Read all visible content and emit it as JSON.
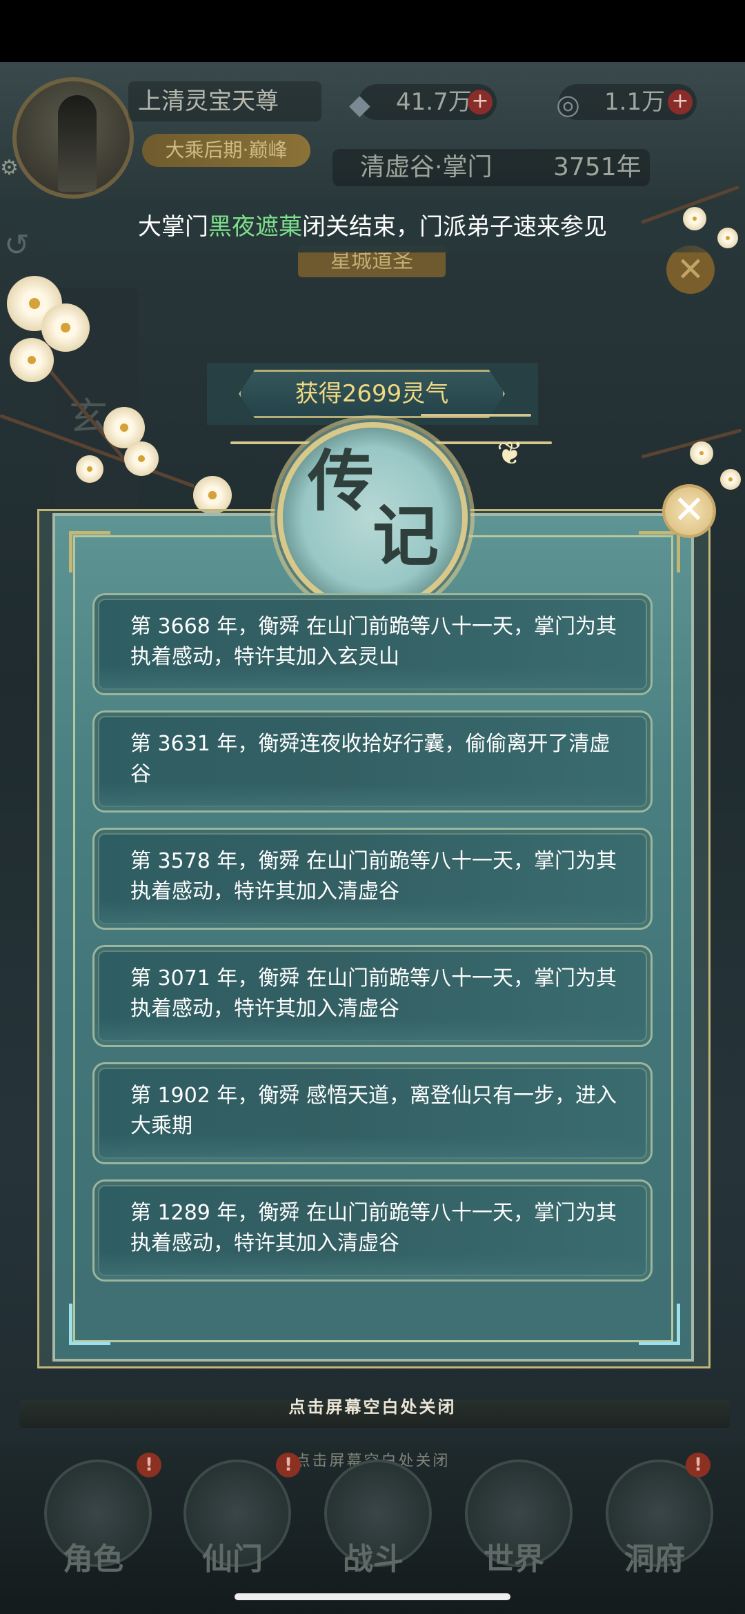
{
  "player": {
    "name": "上清灵宝天尊",
    "rank": "大乘后期·巅峰",
    "settings_icon": "gear-icon"
  },
  "resources": [
    {
      "icon": "spirit-stone-icon",
      "value": "41.7万"
    },
    {
      "icon": "spirit-qi-icon",
      "value": "1.1万"
    }
  ],
  "location": {
    "name": "清虚谷·掌门",
    "year": "3751年"
  },
  "background": {
    "plaque": "星城道圣",
    "side_char": "玄"
  },
  "announcement": {
    "prefix": "大掌门",
    "highlight": "黑夜遮菓",
    "suffix": "闭关结束，门派弟子速来参见",
    "highlight_color": "#7ee08c"
  },
  "modal": {
    "reward": "获得2699灵气",
    "medallion": {
      "char1": "传",
      "char2": "记"
    },
    "close_label": "✕",
    "entries": [
      "第 3668 年，衡舜 在山门前跪等八十一天，掌门为其执着感动，特许其加入玄灵山",
      "第 3631 年，衡舜连夜收拾好行囊，偷偷离开了清虚谷",
      "第 3578 年，衡舜 在山门前跪等八十一天，掌门为其执着感动，特许其加入清虚谷",
      "第 3071 年，衡舜 在山门前跪等八十一天，掌门为其执着感动，特许其加入清虚谷",
      "第 1902 年，衡舜 感悟天道，离登仙只有一步，进入大乘期",
      "第 1289 年，衡舜 在山门前跪等八十一天，掌门为其执着感动，特许其加入清虚谷"
    ]
  },
  "close_hint": "点击屏幕空白处关闭",
  "tabs": [
    {
      "label": "角色",
      "alert": "!"
    },
    {
      "label": "仙门",
      "alert": "!"
    },
    {
      "label": "战斗",
      "alert": ""
    },
    {
      "label": "世界",
      "alert": ""
    },
    {
      "label": "洞府",
      "alert": "!"
    }
  ],
  "colors": {
    "modal_bg": "#4a8081",
    "reward_text": "#f1d983",
    "border_gold": "#c3b679"
  }
}
